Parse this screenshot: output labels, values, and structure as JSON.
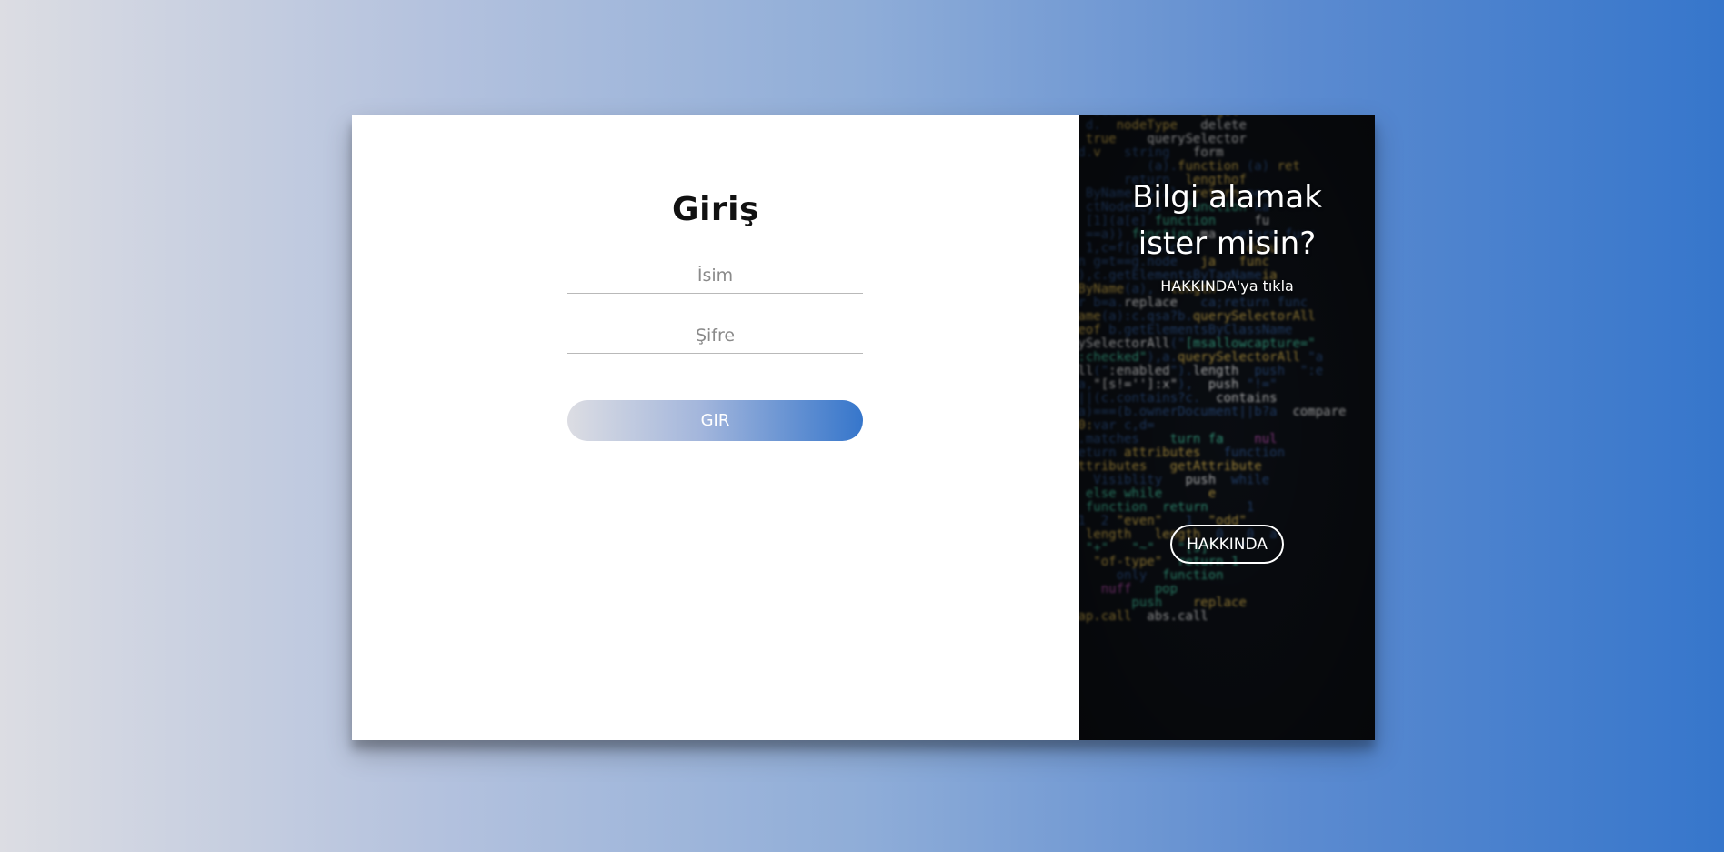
{
  "login": {
    "title": "Giriş",
    "name_placeholder": "İsim",
    "password_placeholder": "Şifre",
    "submit_label": "GIR"
  },
  "info": {
    "title_line1": "Bilgi alamak",
    "title_line2": "ister misin?",
    "subtitle": "HAKKINDA'ya tıkla",
    "about_label": "HAKKINDA"
  },
  "colors": {
    "gradient_start": "#dcdde3",
    "gradient_end": "#3676cb",
    "panel_bg": "#ffffff",
    "info_bg": "#0a0d12"
  }
}
